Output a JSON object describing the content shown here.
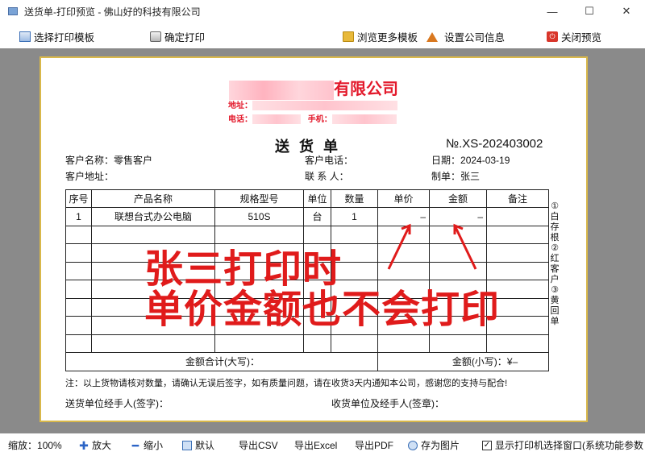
{
  "window": {
    "title": "送货单-打印预览 - 佛山好的科技有限公司",
    "controls": [
      "—",
      "☐",
      "✕"
    ]
  },
  "toolbar": {
    "select_template": "选择打印模板",
    "confirm_print": "确定打印",
    "browse_templates": "浏览更多模板",
    "company_settings": "设置公司信息",
    "close_preview": "关闭预览"
  },
  "document": {
    "company_name_suffix": "有限公司",
    "address_label": "地址：",
    "phone_label": "电话：",
    "mobile_label": "手机：",
    "title": "送货单",
    "number": "№.XS-202403002",
    "customer_name_label": "客户名称：",
    "customer_name": "零售客户",
    "customer_phone_label": "客户电话：",
    "date_label": "日期：",
    "date": "2024-03-19",
    "customer_addr_label": "客户地址：",
    "contact_label": "联 系 人：",
    "maker_label": "制单：",
    "maker": "张三",
    "columns": [
      "序号",
      "产品名称",
      "规格型号",
      "单位",
      "数量",
      "单价",
      "金额",
      "备注"
    ],
    "rows": [
      [
        "1",
        "联想台式办公电脑",
        "510S",
        "台",
        "1",
        "–",
        "–",
        ""
      ]
    ],
    "total_upper_label": "金额合计(大写)：",
    "total_lower_label": "金额(小写)：",
    "total_lower_value": "¥–",
    "copies_note": "①白存根 ②红客户 ③黄回单",
    "note": "注：以上货物请核对数量，请确认无误后签字，如有质量问题，请在收货3天内通知本公司，感谢您的支持与配合!",
    "sender_sign": "送货单位经手人(签字)：",
    "receiver_sign": "收货单位及经手人(签章)："
  },
  "annotation": {
    "line1": "张三打印时",
    "line2": "单价金额也不会打印"
  },
  "bottombar": {
    "zoom_label": "缩放：",
    "zoom_value": "100%",
    "zoom_in": "放大",
    "zoom_out": "缩小",
    "default": "默认",
    "export_csv": "导出CSV",
    "export_excel": "导出Excel",
    "export_pdf": "导出PDF",
    "save_image": "存为图片",
    "show_printer_dialog": "显示打印机选择窗口(系统功能参数"
  }
}
